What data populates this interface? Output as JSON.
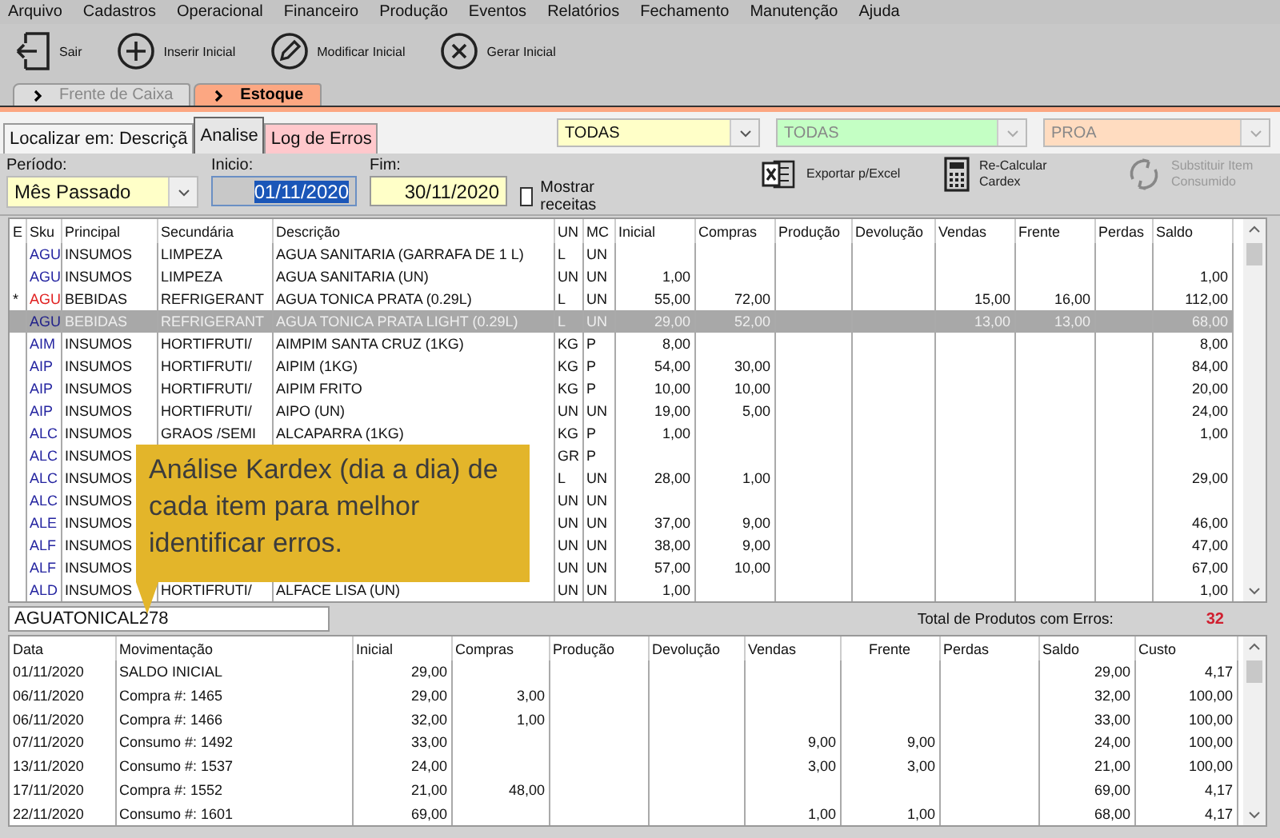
{
  "menu": [
    "Arquivo",
    "Cadastros",
    "Operacional",
    "Financeiro",
    "Produção",
    "Eventos",
    "Relatórios",
    "Fechamento",
    "Manutenção",
    "Ajuda"
  ],
  "toolbar": [
    {
      "kind": "exit",
      "label": "Sair"
    },
    {
      "kind": "add",
      "label": "Inserir Inicial"
    },
    {
      "kind": "edit",
      "label": "Modificar Inicial"
    },
    {
      "kind": "close",
      "label": "Gerar Inicial"
    }
  ],
  "tabs": [
    {
      "label": "Frente de Caixa",
      "selected": false
    },
    {
      "label": "Estoque",
      "selected": true
    }
  ],
  "subtabs": [
    {
      "label": "Localizar em: Descriçã",
      "selected": false,
      "color": "#f4f4f4"
    },
    {
      "label": "Analise",
      "selected": true,
      "color": "#e6e6e6"
    },
    {
      "label": "Log de Erros",
      "selected": false,
      "color": "#ffc8cc"
    }
  ],
  "filters": [
    {
      "value": "TODAS",
      "color": "#ffffc8",
      "disabled": false
    },
    {
      "value": "TODAS",
      "color": "#c4ffc4",
      "disabled": true
    },
    {
      "value": "PROA",
      "color": "#ffdcc0",
      "disabled": true
    }
  ],
  "period": {
    "label": "Período:",
    "value": "Mês Passado"
  },
  "start": {
    "label": "Inicio:",
    "value": "01/11/2020"
  },
  "end": {
    "label": "Fim:",
    "value": "30/11/2020"
  },
  "show_recipes": {
    "label": "Mostrar receitas",
    "checked": false
  },
  "actions": [
    {
      "kind": "excel",
      "label": "Exportar p/Excel",
      "disabled": false
    },
    {
      "kind": "calculator",
      "label": "Re-Calcular Cardex",
      "disabled": false
    },
    {
      "kind": "refresh",
      "label": "Substituir Item Consumido",
      "disabled": true
    }
  ],
  "items_table": {
    "columns": [
      "E",
      "Sku",
      "Principal",
      "Secundária",
      "Descrição",
      "UN",
      "MC",
      "Inicial",
      "Compras",
      "Produção",
      "Devolução",
      "Vendas",
      "Frente",
      "Perdas",
      "Saldo"
    ],
    "rows": [
      {
        "error": false,
        "selected": false,
        "cells": [
          null,
          "AGU",
          "INSUMOS",
          "LIMPEZA",
          "AGUA SANITARIA (GARRAFA DE 1 L)",
          "L",
          "UN",
          null,
          null,
          null,
          null,
          null,
          null,
          null,
          null
        ]
      },
      {
        "error": false,
        "selected": false,
        "cells": [
          null,
          "AGU",
          "INSUMOS",
          "LIMPEZA",
          "AGUA SANITARIA (UN)",
          "UN",
          "UN",
          "1,00",
          null,
          null,
          null,
          null,
          null,
          null,
          "1,00"
        ]
      },
      {
        "error": true,
        "selected": false,
        "cells": [
          "*",
          "AGU",
          "BEBIDAS",
          "REFRIGERANT",
          "AGUA TONICA PRATA (0.29L)",
          "L",
          "UN",
          "55,00",
          "72,00",
          null,
          null,
          "15,00",
          "16,00",
          null,
          "112,00"
        ]
      },
      {
        "error": false,
        "selected": true,
        "cells": [
          null,
          "AGU",
          "BEBIDAS",
          "REFRIGERANT",
          "AGUA TONICA PRATA LIGHT (0.29L)",
          "L",
          "UN",
          "29,00",
          "52,00",
          null,
          null,
          "13,00",
          "13,00",
          null,
          "68,00"
        ]
      },
      {
        "error": false,
        "selected": false,
        "cells": [
          null,
          "AIM",
          "INSUMOS",
          "HORTIFRUTI/",
          "AIMPIM SANTA CRUZ (1KG)",
          "KG",
          "P",
          "8,00",
          null,
          null,
          null,
          null,
          null,
          null,
          "8,00"
        ]
      },
      {
        "error": false,
        "selected": false,
        "cells": [
          null,
          "AIP",
          "INSUMOS",
          "HORTIFRUTI/",
          "AIPIM (1KG)",
          "KG",
          "P",
          "54,00",
          "30,00",
          null,
          null,
          null,
          null,
          null,
          "84,00"
        ]
      },
      {
        "error": false,
        "selected": false,
        "cells": [
          null,
          "AIP",
          "INSUMOS",
          "HORTIFRUTI/",
          "AIPIM FRITO",
          "KG",
          "P",
          "10,00",
          "10,00",
          null,
          null,
          null,
          null,
          null,
          "20,00"
        ]
      },
      {
        "error": false,
        "selected": false,
        "cells": [
          null,
          "AIP",
          "INSUMOS",
          "HORTIFRUTI/",
          "AIPO (UN)",
          "UN",
          "UN",
          "19,00",
          "5,00",
          null,
          null,
          null,
          null,
          null,
          "24,00"
        ]
      },
      {
        "error": false,
        "selected": false,
        "cells": [
          null,
          "ALC",
          "INSUMOS",
          "GRAOS /SEMI",
          "ALCAPARRA (1KG)",
          "KG",
          "P",
          "1,00",
          null,
          null,
          null,
          null,
          null,
          null,
          "1,00"
        ]
      },
      {
        "error": false,
        "selected": false,
        "cells": [
          null,
          "ALC",
          "INSUMOS",
          null,
          null,
          "GR",
          "P",
          null,
          null,
          null,
          null,
          null,
          null,
          null,
          null
        ]
      },
      {
        "error": false,
        "selected": false,
        "cells": [
          null,
          "ALC",
          "INSUMOS",
          null,
          null,
          "L",
          "UN",
          "28,00",
          "1,00",
          null,
          null,
          null,
          null,
          null,
          "29,00"
        ]
      },
      {
        "error": false,
        "selected": false,
        "cells": [
          null,
          "ALC",
          "INSUMOS",
          null,
          null,
          "UN",
          "UN",
          null,
          null,
          null,
          null,
          null,
          null,
          null,
          null
        ]
      },
      {
        "error": false,
        "selected": false,
        "cells": [
          null,
          "ALE",
          "INSUMOS",
          null,
          null,
          "UN",
          "UN",
          "37,00",
          "9,00",
          null,
          null,
          null,
          null,
          null,
          "46,00"
        ]
      },
      {
        "error": false,
        "selected": false,
        "cells": [
          null,
          "ALF",
          "INSUMOS",
          null,
          null,
          "UN",
          "UN",
          "38,00",
          "9,00",
          null,
          null,
          null,
          null,
          null,
          "47,00"
        ]
      },
      {
        "error": false,
        "selected": false,
        "cells": [
          null,
          "ALF",
          "INSUMOS",
          null,
          null,
          "UN",
          "UN",
          "57,00",
          "10,00",
          null,
          null,
          null,
          null,
          null,
          "67,00"
        ]
      },
      {
        "error": false,
        "selected": false,
        "cells": [
          null,
          "ALD",
          "INSUMOS",
          "HORTIFRUTI/",
          "ALFACE LISA (UN)",
          "UN",
          "UN",
          "1,00",
          null,
          null,
          null,
          null,
          null,
          null,
          "1,00"
        ]
      }
    ]
  },
  "callout": "Análise Kardex (dia a dia) de cada item para melhor identificar erros.",
  "product_code": "AGUATONICAL278",
  "error_total": {
    "label": "Total de Produtos com Erros:",
    "value": "32"
  },
  "kardex_table": {
    "columns": [
      "Data",
      "Movimentação",
      "Inicial",
      "Compras",
      "Produção",
      "Devolução",
      "Vendas",
      "Frente",
      "Perdas",
      "Saldo",
      "Custo"
    ],
    "rows": [
      [
        "01/11/2020",
        "SALDO INICIAL",
        "29,00",
        null,
        null,
        null,
        null,
        null,
        null,
        "29,00",
        "4,17"
      ],
      [
        "06/11/2020",
        "Compra #: 1465",
        "29,00",
        "3,00",
        null,
        null,
        null,
        null,
        null,
        "32,00",
        "100,00"
      ],
      [
        "06/11/2020",
        "Compra #: 1466",
        "32,00",
        "1,00",
        null,
        null,
        null,
        null,
        null,
        "33,00",
        "100,00"
      ],
      [
        "07/11/2020",
        "Consumo #: 1492",
        "33,00",
        null,
        null,
        null,
        "9,00",
        "9,00",
        null,
        "24,00",
        "100,00"
      ],
      [
        "13/11/2020",
        "Consumo #: 1537",
        "24,00",
        null,
        null,
        null,
        "3,00",
        "3,00",
        null,
        "21,00",
        "100,00"
      ],
      [
        "17/11/2020",
        "Compra #: 1552",
        "21,00",
        "48,00",
        null,
        null,
        null,
        null,
        null,
        "69,00",
        "4,17"
      ],
      [
        "22/11/2020",
        "Consumo #: 1601",
        "69,00",
        null,
        null,
        null,
        "1,00",
        "1,00",
        null,
        "68,00",
        "4,17"
      ]
    ]
  }
}
